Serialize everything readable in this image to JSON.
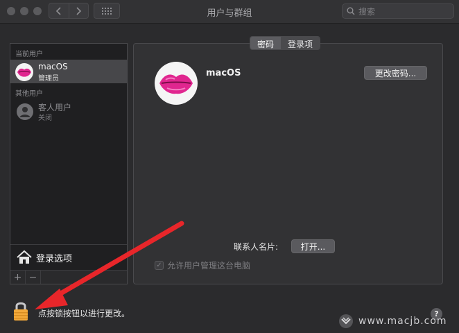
{
  "window": {
    "title": "用户与群组"
  },
  "toolbar": {
    "search_placeholder": "搜索"
  },
  "sidebar": {
    "current_users_header": "当前用户",
    "current_user": {
      "name": "macOS",
      "role": "管理员"
    },
    "other_users_header": "其他用户",
    "guest_user": {
      "name": "客人用户",
      "status": "关闭"
    },
    "login_options_label": "登录选项",
    "add_label": "+",
    "remove_label": "−"
  },
  "tabs": [
    {
      "label": "密码",
      "active": true
    },
    {
      "label": "登录项",
      "active": false
    }
  ],
  "main": {
    "username": "macOS",
    "change_password_label": "更改密码...",
    "contact_card_label": "联系人名片:",
    "open_label": "打开...",
    "allow_admin_label": "允许用户管理这台电脑",
    "allow_admin_checked": true
  },
  "footer": {
    "lock_text": "点按锁按钮以进行更改。",
    "help_label": "?",
    "watermark": "www.macjb.com"
  },
  "colors": {
    "background": "#2b2b2d",
    "sidebar": "#1f1f21",
    "selection": "#47474a",
    "arrow": "#e8262a",
    "lock": "#f3a93a"
  },
  "icons": {
    "back": "chevron-left-icon",
    "forward": "chevron-right-icon",
    "grid": "grid-icon",
    "search": "search-icon",
    "avatar": "lips-icon",
    "guest": "person-icon",
    "login_options": "house-icon",
    "lock": "lock-icon",
    "help": "help-icon"
  }
}
